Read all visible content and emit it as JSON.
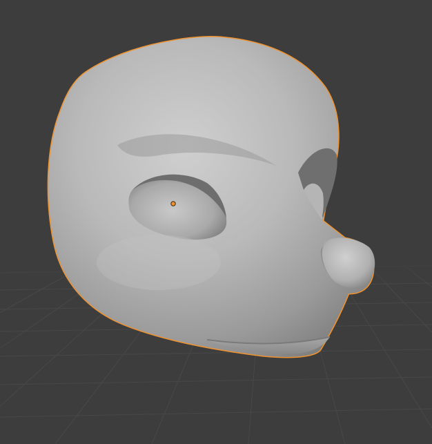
{
  "viewport": {
    "background_color": "#3d3d3d",
    "grid_color": "#4a4a4a",
    "selection_outline_color": "#f0922e",
    "origin_point_color": "#f0922e",
    "mesh_base_color": "#b7b7b7",
    "mesh_shadow_color": "#7e7e7e",
    "mesh_highlight_color": "#d6d6d6"
  },
  "object": {
    "icon": "fursuit-head-mesh",
    "selected": true
  }
}
